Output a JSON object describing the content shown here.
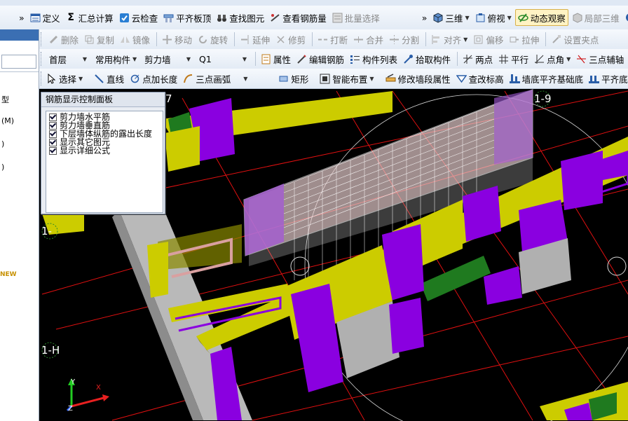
{
  "toolbar1": {
    "more": "»",
    "items": [
      "定义",
      "汇总计算",
      "云检查",
      "平齐板顶",
      "查找图元",
      "查看钢筋量",
      "批量选择"
    ],
    "right": [
      "三维",
      "俯视",
      "动态观察",
      "局部三维"
    ]
  },
  "toolbar2": {
    "items": [
      "删除",
      "复制",
      "镜像",
      "移动",
      "旋转",
      "延伸",
      "修剪",
      "打断",
      "合并",
      "分割",
      "对齐",
      "偏移",
      "拉伸",
      "设置夹点"
    ]
  },
  "toolbar3": {
    "floor": "首层",
    "category": "常用构件",
    "type": "剪力墙",
    "name": "Q1",
    "items": [
      "属性",
      "编辑钢筋",
      "构件列表",
      "拾取构件",
      "两点",
      "平行",
      "点角",
      "三点辅轴"
    ]
  },
  "toolbar4": {
    "items": [
      "选择",
      "直线",
      "点加长度",
      "三点画弧",
      "矩形",
      "智能布置",
      "修改墙段属性",
      "查改标高",
      "墙底平齐基础底",
      "平齐底"
    ]
  },
  "left_panel": {
    "label_type": "型",
    "label_m": "(M)",
    "label_paren1": ")",
    "label_paren2": ")",
    "label_new": "NEW"
  },
  "rebar_panel": {
    "title": "钢筋显示控制面板",
    "options": [
      {
        "label": "剪力墙水平筋",
        "checked": true
      },
      {
        "label": "剪力墙垂直筋",
        "checked": true
      },
      {
        "label": "下层墙体纵筋的露出长度",
        "checked": true
      },
      {
        "label": "显示其它图元",
        "checked": true
      },
      {
        "label": "显示详细公式",
        "checked": true
      }
    ]
  },
  "viewport": {
    "axis_labels": [
      "1-9",
      "1-H",
      "1-",
      "7"
    ],
    "gizmo": {
      "x": "X",
      "y": "Y",
      "z": "Z"
    },
    "colors": {
      "wall": "#cccc00",
      "column": "#8a00e0",
      "slab": "#1f7a1f",
      "beam": "#b0b0b0",
      "grid": "#ff0000"
    }
  }
}
